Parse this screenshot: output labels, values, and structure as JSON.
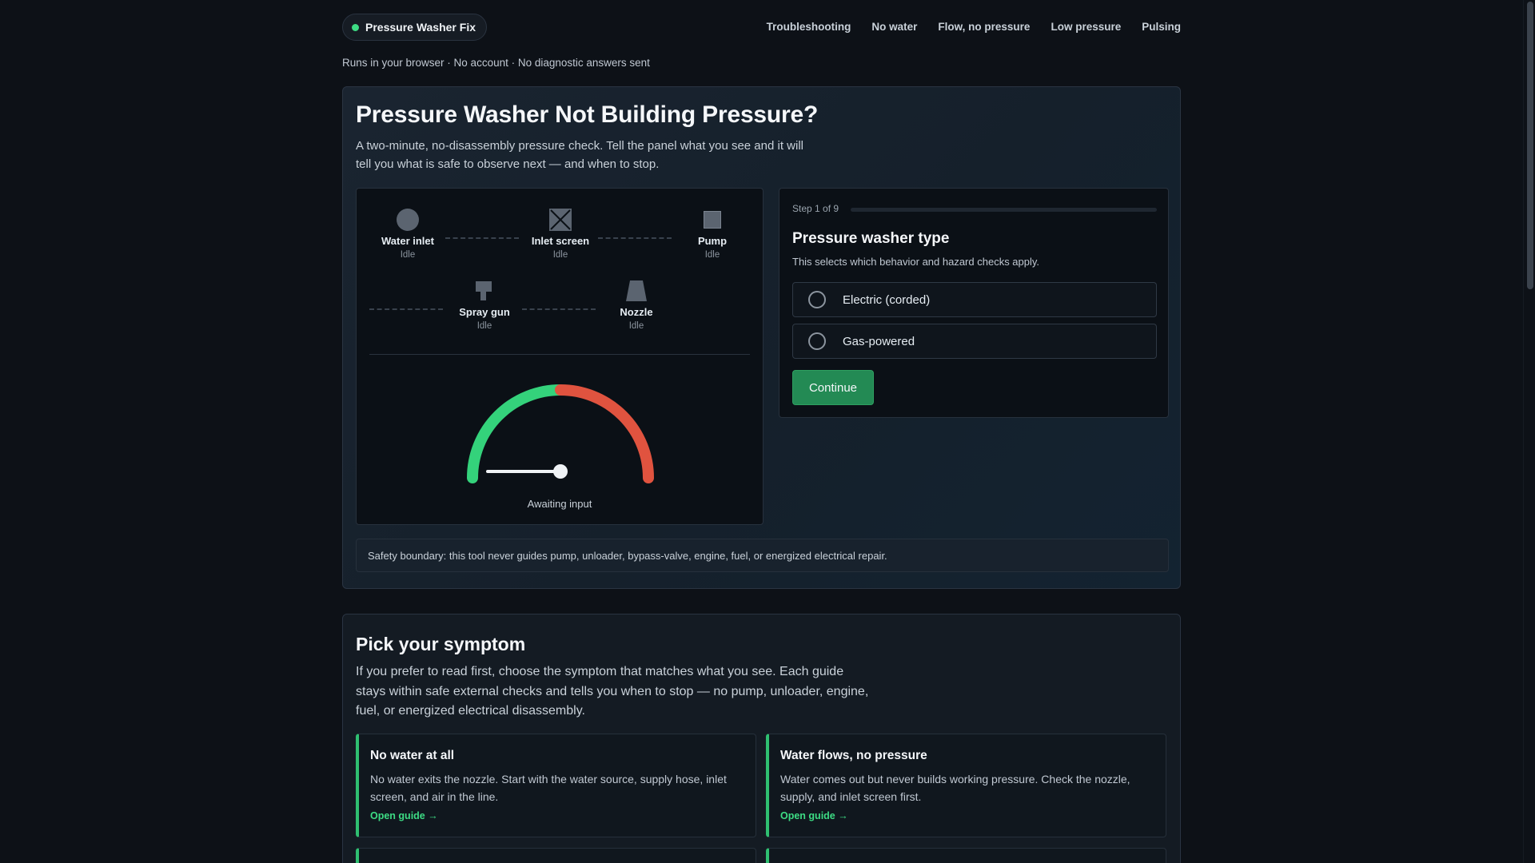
{
  "brand": {
    "name": "Pressure Washer Fix"
  },
  "nav": {
    "items": [
      "Troubleshooting",
      "No water",
      "Flow, no pressure",
      "Low pressure",
      "Pulsing"
    ]
  },
  "privacy_note": "Runs in your browser · No account · No diagnostic answers sent",
  "hero": {
    "title": "Pressure Washer Not Building Pressure?",
    "lead": "A two-minute, no-disassembly pressure check. Tell the panel what you see and it will tell you what is safe to observe next — and when to stop."
  },
  "diagram": {
    "components": [
      {
        "name": "Water inlet",
        "status": "Idle",
        "icon": "circle-icon"
      },
      {
        "name": "Inlet screen",
        "status": "Idle",
        "icon": "screen-x-icon"
      },
      {
        "name": "Pump",
        "status": "Idle",
        "icon": "square-icon"
      },
      {
        "name": "Spray gun",
        "status": "Idle",
        "icon": "spray-gun-icon"
      },
      {
        "name": "Nozzle",
        "status": "Idle",
        "icon": "nozzle-icon"
      }
    ],
    "gauge": {
      "label": "Awaiting input",
      "value_fraction": 0.5,
      "colors": {
        "low": "#34d27b",
        "high": "#e0533f"
      }
    }
  },
  "wizard": {
    "step_label": "Step 1 of 9",
    "progress_fraction": 0.0,
    "title": "Pressure washer type",
    "subtitle": "This selects which behavior and hazard checks apply.",
    "options": [
      "Electric (corded)",
      "Gas-powered"
    ],
    "continue_label": "Continue"
  },
  "safety_note": "Safety boundary: this tool never guides pump, unloader, bypass-valve, engine, fuel, or energized electrical repair.",
  "symptoms": {
    "title": "Pick your symptom",
    "intro": "If you prefer to read first, choose the symptom that matches what you see. Each guide stays within safe external checks and tells you when to stop — no pump, unloader, engine, fuel, or energized electrical disassembly.",
    "cards": [
      {
        "title": "No water at all",
        "body": "No water exits the nozzle. Start with the water source, supply hose, inlet screen, and air in the line.",
        "link": "Open guide →"
      },
      {
        "title": "Water flows, no pressure",
        "body": "Water comes out but never builds working pressure. Check the nozzle, supply, and inlet screen first.",
        "link": "Open guide →"
      }
    ]
  },
  "theme": {
    "accent": "#3ddc84",
    "button": "#238a54",
    "background": "#0d1117"
  }
}
